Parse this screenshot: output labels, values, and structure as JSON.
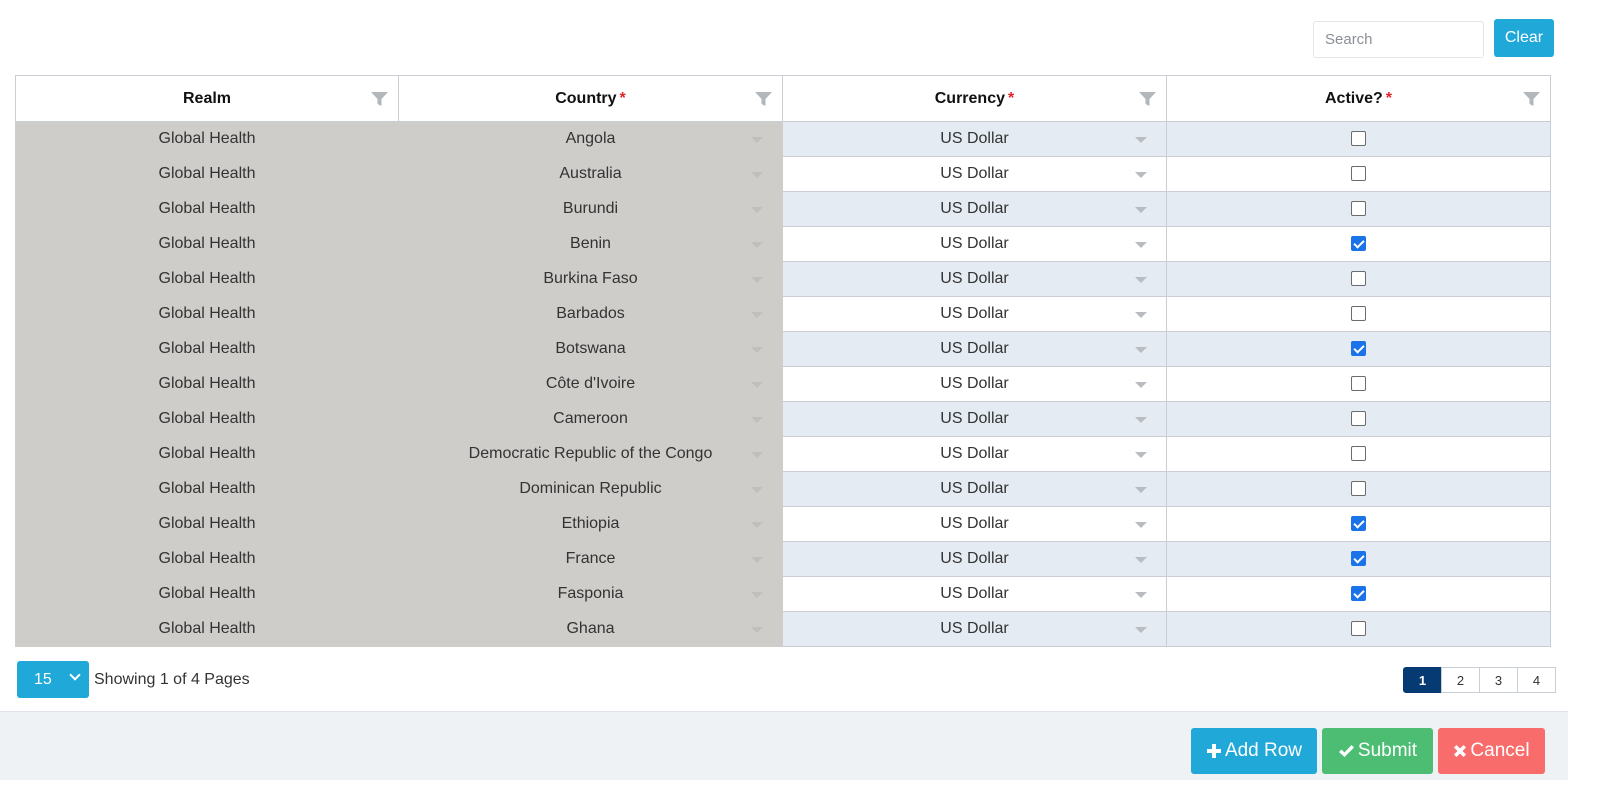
{
  "search": {
    "placeholder": "Search",
    "value": ""
  },
  "clear_label": "Clear",
  "columns": [
    {
      "label": "Realm",
      "required": false
    },
    {
      "label": "Country",
      "required": true
    },
    {
      "label": "Currency",
      "required": true
    },
    {
      "label": "Active?",
      "required": true
    }
  ],
  "required_marker": "*",
  "rows": [
    {
      "realm": "Global Health",
      "country": "Angola",
      "currency": "US Dollar",
      "active": false
    },
    {
      "realm": "Global Health",
      "country": "Australia",
      "currency": "US Dollar",
      "active": false
    },
    {
      "realm": "Global Health",
      "country": "Burundi",
      "currency": "US Dollar",
      "active": false
    },
    {
      "realm": "Global Health",
      "country": "Benin",
      "currency": "US Dollar",
      "active": true
    },
    {
      "realm": "Global Health",
      "country": "Burkina Faso",
      "currency": "US Dollar",
      "active": false
    },
    {
      "realm": "Global Health",
      "country": "Barbados",
      "currency": "US Dollar",
      "active": false
    },
    {
      "realm": "Global Health",
      "country": "Botswana",
      "currency": "US Dollar",
      "active": true
    },
    {
      "realm": "Global Health",
      "country": "Côte d'Ivoire",
      "currency": "US Dollar",
      "active": false
    },
    {
      "realm": "Global Health",
      "country": "Cameroon",
      "currency": "US Dollar",
      "active": false
    },
    {
      "realm": "Global Health",
      "country": "Democratic Republic of the Congo",
      "currency": "US Dollar",
      "active": false
    },
    {
      "realm": "Global Health",
      "country": "Dominican Republic",
      "currency": "US Dollar",
      "active": false
    },
    {
      "realm": "Global Health",
      "country": "Ethiopia",
      "currency": "US Dollar",
      "active": true
    },
    {
      "realm": "Global Health",
      "country": "France",
      "currency": "US Dollar",
      "active": true
    },
    {
      "realm": "Global Health",
      "country": "Fasponia",
      "currency": "US Dollar",
      "active": true
    },
    {
      "realm": "Global Health",
      "country": "Ghana",
      "currency": "US Dollar",
      "active": false
    }
  ],
  "pager": {
    "page_size": "15",
    "info": "Showing 1 of 4 Pages",
    "pages": [
      "1",
      "2",
      "3",
      "4"
    ],
    "current_page": "1"
  },
  "buttons": {
    "add_row": "Add Row",
    "submit": "Submit",
    "cancel": "Cancel"
  },
  "colors": {
    "primary": "#20a8d8",
    "success": "#4dbd74",
    "danger": "#f86c6b",
    "active_page": "#063a72",
    "readonly_cell": "#cfcdca",
    "stripe": "#e4ebf3",
    "checkbox_checked": "#1a73e8"
  },
  "icons": {
    "column_filter": "filter-icon",
    "dropdown": "caret-down-icon",
    "page_size": "chevron-down-icon",
    "add_row": "plus-icon",
    "submit": "check-icon",
    "cancel": "times-icon"
  }
}
